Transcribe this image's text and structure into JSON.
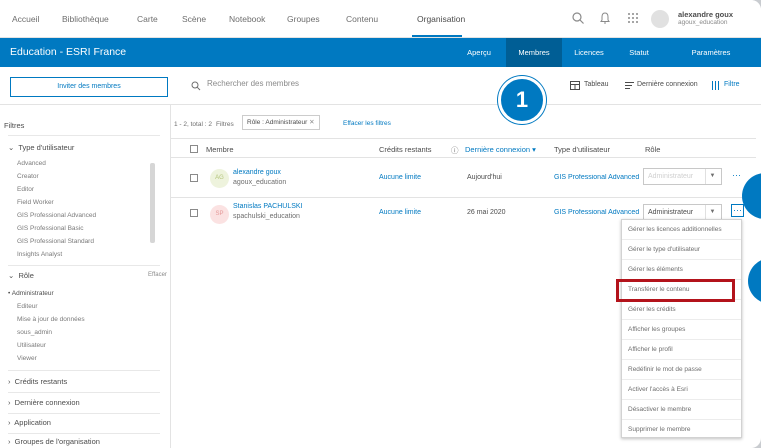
{
  "topnav": {
    "items": [
      "Accueil",
      "Bibliothèque",
      "Carte",
      "Scène",
      "Notebook",
      "Groupes",
      "Contenu",
      "Organisation"
    ],
    "active": "Organisation",
    "icons": [
      "search-icon",
      "bell-icon",
      "apps-grid-icon"
    ],
    "user": {
      "name": "alexandre goux",
      "handle": "agoux_education"
    }
  },
  "orgbar": {
    "title": "Education - ESRI France",
    "tabs": [
      "Aperçu",
      "Membres",
      "Licences",
      "Statut",
      "Paramètres"
    ],
    "selected_tab": "Membres",
    "color": "#0079c1"
  },
  "toolbar": {
    "invite_label": "Inviter des membres",
    "search_placeholder": "Rechercher des membres",
    "table_label": "Tableau",
    "sort_label": "Dernière connexion",
    "filter_label": "Filtre"
  },
  "sidebar": {
    "filters_title": "Filtres",
    "user_type_head": "Type d'utilisateur",
    "user_types": [
      "Advanced",
      "Creator",
      "Editor",
      "Field Worker",
      "GIS Professional Advanced",
      "GIS Professional Basic",
      "GIS Professional Standard",
      "Insights Analyst"
    ],
    "role_head": "Rôle",
    "role_clear": "Effacer",
    "roles": [
      "Administrateur",
      "Editeur",
      "Mise à jour de données",
      "sous_admin",
      "Utilisateur",
      "Viewer"
    ],
    "sections": [
      "Crédits restants",
      "Dernière connexion",
      "Application",
      "Groupes de l'organisation"
    ]
  },
  "main": {
    "count_text": "1 - 2, total : 2",
    "filters_label": "Filtres",
    "chip_label": "Rôle : Administrateur",
    "clear_filters": "Effacer les filtres",
    "columns": [
      "Membre",
      "Crédits restants",
      "Dernière connexion",
      "Type d'utilisateur",
      "Rôle"
    ],
    "rows": [
      {
        "initials": "AG",
        "name": "alexandre goux",
        "handle": "agoux_education",
        "credits": "Aucune limite",
        "last_login": "Aujourd'hui",
        "user_type": "GIS Professional Advanced",
        "role": "Administrateur"
      },
      {
        "initials": "SP",
        "name": "Stanislas PACHULSKI",
        "handle": "spachulski_education",
        "credits": "Aucune limite",
        "last_login": "26 mai 2020",
        "user_type": "GIS Professional Advanced",
        "role": "Administrateur"
      }
    ]
  },
  "menu": {
    "items": [
      "Gérer les licences additionnelles",
      "Gérer le type d'utilisateur",
      "Gérer les éléments",
      "Transférer le contenu",
      "Gérer les crédits",
      "Afficher les groupes",
      "Afficher le profil",
      "Redéfinir le mot de passe",
      "Activer l'accès à Esri",
      "Désactiver le membre",
      "Supprimer le membre"
    ],
    "highlighted": "Transférer le contenu",
    "highlight_color": "#b3131b"
  },
  "annotation": {
    "step_number": "1"
  }
}
